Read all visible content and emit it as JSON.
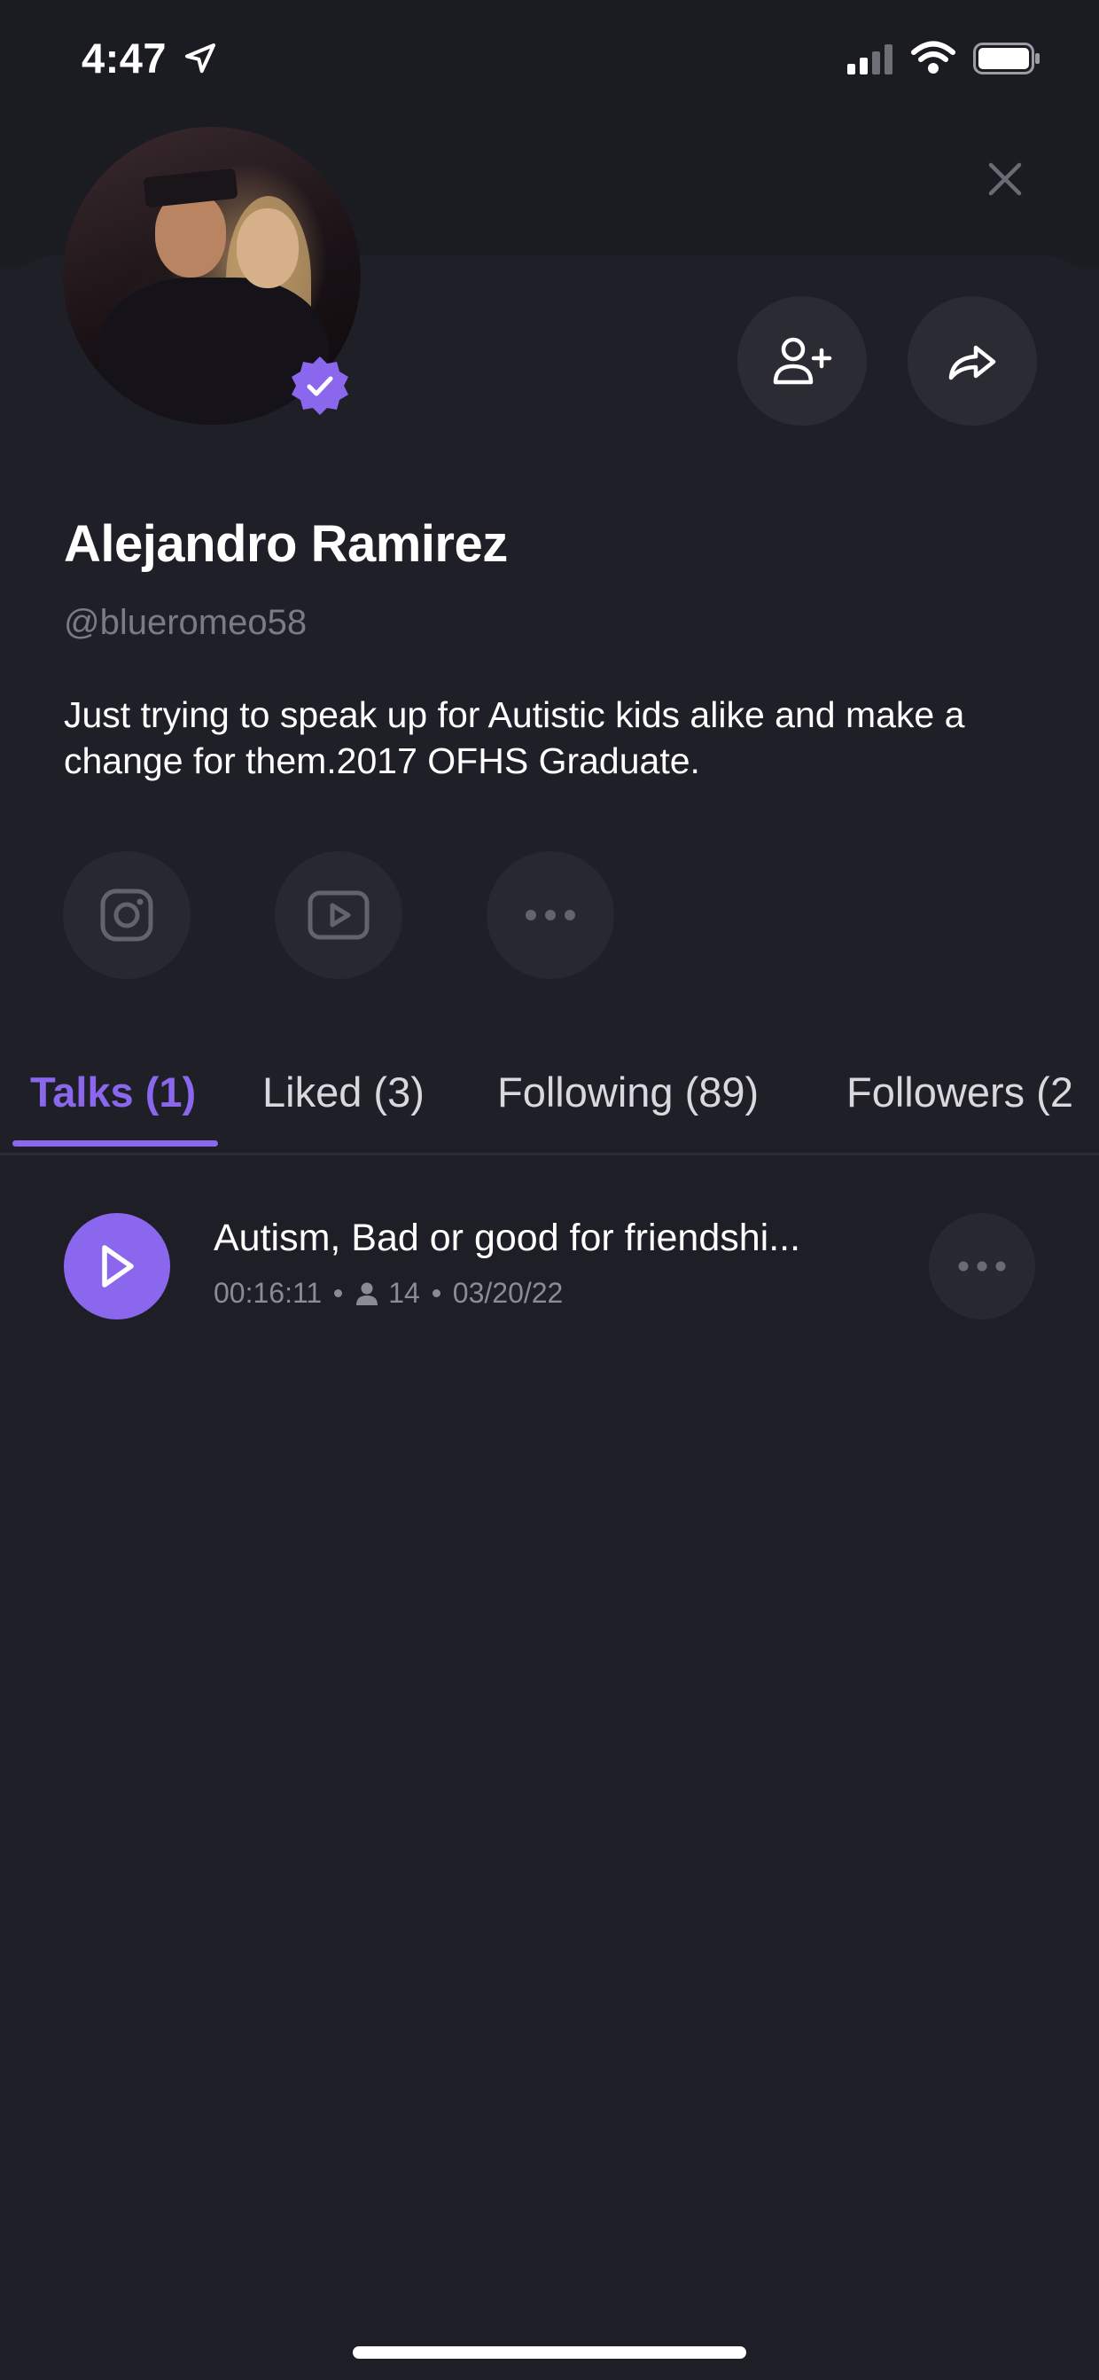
{
  "status": {
    "time": "4:47"
  },
  "profile": {
    "name": "Alejandro Ramirez",
    "handle": "@blueromeo58",
    "bio": "Just trying to speak up for Autistic kids alike and make a change for them.2017 OFHS Graduate.",
    "verified": true
  },
  "icons": {
    "close": "close-icon",
    "add_friend": "user-plus-icon",
    "share": "share-arrow-icon",
    "instagram": "instagram-icon",
    "youtube": "youtube-icon",
    "more": "more-dots-icon"
  },
  "tabs": [
    {
      "label": "Talks (1)",
      "active": true
    },
    {
      "label": "Liked (3)",
      "active": false
    },
    {
      "label": "Following (89)",
      "active": false
    },
    {
      "label": "Followers (2",
      "active": false
    }
  ],
  "talks": [
    {
      "title": "Autism, Bad or good for friendshi...",
      "duration": "00:16:11",
      "listeners": "14",
      "date": "03/20/22"
    }
  ],
  "colors": {
    "accent": "#8b67ee",
    "background": "#1e1f26",
    "button": "#2a2b33"
  }
}
